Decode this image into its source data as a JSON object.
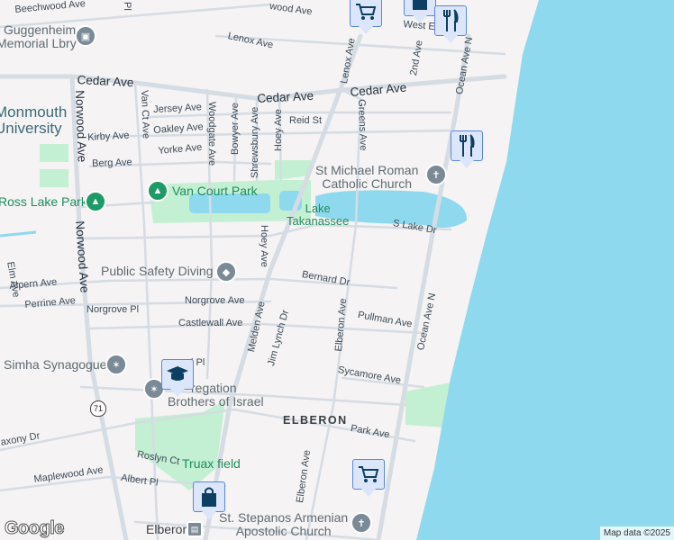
{
  "streets": {
    "beechwood": "Beechwood Ave",
    "wood_ave": "wood Ave",
    "pl_top": "Pl",
    "lenox": "Lenox Ave",
    "cedar1": "Cedar Ave",
    "cedar2": "Cedar Ave",
    "cedar3": "Cedar Ave",
    "norwood1": "Norwood Ave",
    "norwood2": "Norwood Ave",
    "van_ct": "Van Ct Ave",
    "jersey": "Jersey Ave",
    "oakley": "Oakley Ave",
    "kirby": "Kirby Ave",
    "yorke": "Yorke Ave",
    "berg": "Berg Ave",
    "woodgate": "Woodgate Ave",
    "bowyer": "Bowyer Ave",
    "shrewsbury": "Shrewsbury Ave",
    "hoey1": "Hoey Ave",
    "hoey2": "Hoey Ave",
    "reid": "Reid St",
    "lenox_v": "Lenox Ave",
    "greens": "Greens Ave",
    "second": "2nd Ave",
    "ocean1": "Ocean Ave N",
    "ocean2": "Ocean Ave N",
    "west_e": "West E",
    "s_lake": "S Lake Dr",
    "elm": "Elm Ave",
    "alpern": "Alpern Ave",
    "perrine": "Perrine Ave",
    "norgrove_ave": "Norgrove Ave",
    "norgrove_pl": "Norgrove Pl",
    "castlewall": "Castlewall Ave",
    "bernard": "Bernard Dr",
    "melden": "Melden Ave",
    "jim_lynch": "Jim Lynch Dr",
    "elberon1": "Elberon Ave",
    "elberon2": "Elberon Ave",
    "pullman": "Pullman Ave",
    "sycamore": "Sycamore Ave",
    "pl_mid": "l Pl",
    "park": "Park Ave",
    "saxony": "axony Dr",
    "roslyn": "Roslyn Ct",
    "maplewood": "Maplewood Ave",
    "albert": "Albert Pl",
    "route": "71"
  },
  "places": {
    "library": [
      "Guggenheim",
      "Memorial Lbry"
    ],
    "university": [
      "Monmouth",
      "University"
    ],
    "church": [
      "St Michael Roman",
      "Catholic Church"
    ],
    "van_court_park": "Van Court Park",
    "ross_lake_park": "Ross Lake Park",
    "lake": [
      "Lake",
      "Takanassee"
    ],
    "public_safety": "Public Safety Diving",
    "simha": "Simha Synagogue",
    "congregation": [
      "regation",
      "Brothers of Israel"
    ],
    "neighborhood": "ELBERON",
    "truax": "Truax field",
    "armenian": [
      "St. Stepanos Armenian",
      "Apostolic Church"
    ],
    "station": "Elberon"
  },
  "footer": {
    "logo": "Google",
    "attribution": "Map data ©2025"
  },
  "colors": {
    "water": "#8fd9ee",
    "park": "#c3efd2",
    "road": "#d5dce3",
    "pin_bg": "#dbe6fb",
    "pin_icon": "#0d3f63"
  }
}
